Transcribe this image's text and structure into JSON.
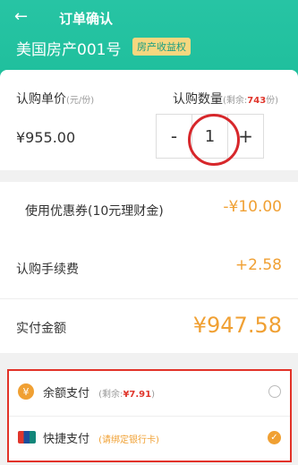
{
  "header": {
    "back_icon": "arrow-left-icon",
    "title": "订单确认",
    "product_name": "美国房产001号",
    "badge": "房产收益权"
  },
  "purchase": {
    "unit_price_label": "认购单价",
    "unit_price_unit": "(元/份)",
    "unit_price": "¥955.00",
    "quantity_label": "认购数量",
    "remaining_prefix": "(剩余:",
    "remaining_value": "743",
    "remaining_suffix": "份)",
    "minus": "-",
    "quantity": "1",
    "plus": "+"
  },
  "coupon": {
    "label": "使用优惠券(10元理财金)",
    "value": "-¥10.00"
  },
  "fee": {
    "label": "认购手续费",
    "value": "+2.58"
  },
  "total": {
    "label": "实付金额",
    "value": "¥947.58"
  },
  "payment": {
    "balance": {
      "label": "余额支付",
      "sub_prefix": "(剩余:",
      "sub_value": "¥7.91",
      "sub_suffix": ")",
      "icon": "coin-bag-icon"
    },
    "quick": {
      "label": "快捷支付",
      "sub": "(请绑定银行卡)",
      "icon": "unionpay-icon"
    }
  },
  "colors": {
    "brand": "#1fbf9c",
    "accent": "#f0a033",
    "highlight": "#e23228"
  }
}
